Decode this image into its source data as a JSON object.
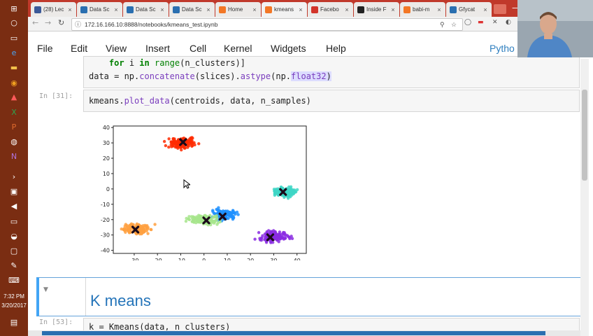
{
  "browser": {
    "tabs": [
      {
        "label": "(28) Lec",
        "favicon": "facebook-icon",
        "color": "#3b5998"
      },
      {
        "label": "Data Sc",
        "favicon": "k-icon",
        "color": "#2a6fb0"
      },
      {
        "label": "Data Sc",
        "favicon": "k-icon",
        "color": "#2a6fb0"
      },
      {
        "label": "Data Sc",
        "favicon": "k-icon",
        "color": "#2a6fb0"
      },
      {
        "label": "Home",
        "favicon": "jupyter-icon",
        "color": "#f37726"
      },
      {
        "label": "kmeans",
        "favicon": "jupyter-icon",
        "color": "#f37726"
      },
      {
        "label": "Facebo",
        "favicon": "s-icon",
        "color": "#d2342a"
      },
      {
        "label": "Inside F",
        "favicon": "github-icon",
        "color": "#222222"
      },
      {
        "label": "babi-m",
        "favicon": "jupyter-icon",
        "color": "#f37726"
      },
      {
        "label": "Gfycat",
        "favicon": "gfycat-icon",
        "color": "#2a6fb0"
      }
    ],
    "url": "172.16.166.10:8888/notebooks/kmeans_test.ipynb"
  },
  "jupyter": {
    "menu": [
      "File",
      "Edit",
      "View",
      "Insert",
      "Cell",
      "Kernel",
      "Widgets",
      "Help"
    ],
    "kernel_label": "Pytho",
    "cell1": {
      "line1": {
        "indent": "    ",
        "kw_for": "for",
        "var": " i ",
        "kw_in": "in",
        "space": " ",
        "range": "range",
        "rest": "(n_clusters)]"
      },
      "line2": {
        "a": "data = np.",
        "b": "concatenate",
        "c": "(slices).",
        "d": "astype",
        "e": "(np.",
        "f": "float32",
        "g": ")"
      }
    },
    "cell2": {
      "prompt": "In [31]:",
      "a": "kmeans.",
      "b": "plot_data",
      "c": "(centroids, data, n_samples)"
    },
    "markdown": {
      "heading": "K means"
    },
    "cell3": {
      "prompt": "In [53]:",
      "code": "k = Kmeans(data, n_clusters)"
    }
  },
  "taskbar": {
    "time": "7:32 PM",
    "date": "3/20/2017"
  },
  "chart_data": {
    "type": "scatter",
    "xticks": [
      -30,
      -20,
      -10,
      0,
      10,
      20,
      30,
      40
    ],
    "yticks": [
      -40,
      -30,
      -20,
      -10,
      0,
      10,
      20,
      30,
      40
    ],
    "xlim": [
      -39,
      44
    ],
    "ylim": [
      -42,
      41
    ],
    "grid": false,
    "clusters": [
      {
        "color": "#ff2a00",
        "center": [
          -9,
          30
        ],
        "spread": [
          5,
          2.8
        ],
        "centroid": [
          -9,
          30.5
        ]
      },
      {
        "color": "#3ed6c5",
        "center": [
          35,
          -2
        ],
        "spread": [
          4.5,
          2.6
        ],
        "centroid": [
          34,
          -2
        ]
      },
      {
        "color": "#1e90ff",
        "center": [
          9,
          -17
        ],
        "spread": [
          4.5,
          2.8
        ],
        "centroid": [
          8,
          -18
        ]
      },
      {
        "color": "#a7e58c",
        "center": [
          0,
          -20
        ],
        "spread": [
          5.5,
          2.6
        ],
        "centroid": [
          1,
          -20.5
        ]
      },
      {
        "color": "#ffa040",
        "center": [
          -29,
          -26
        ],
        "spread": [
          5,
          2.8
        ],
        "centroid": [
          -29.5,
          -26.5
        ]
      },
      {
        "color": "#8a2be2",
        "center": [
          30,
          -31
        ],
        "spread": [
          5.5,
          3
        ],
        "centroid": [
          28.5,
          -31.5
        ]
      }
    ]
  }
}
